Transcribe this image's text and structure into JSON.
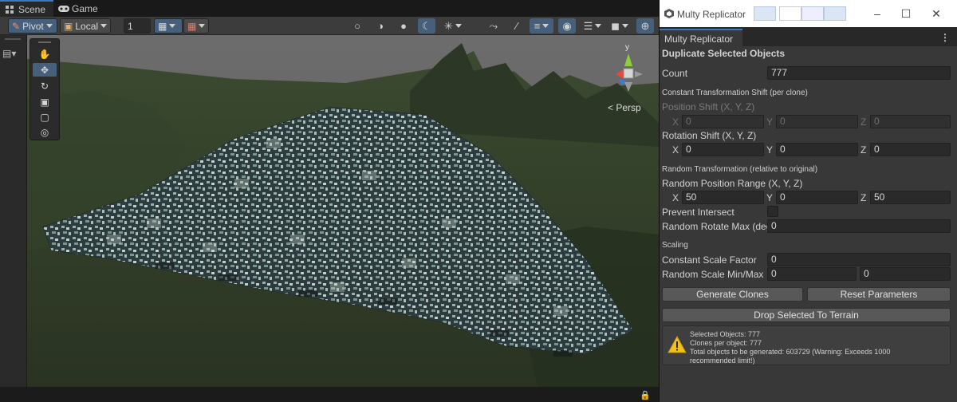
{
  "scene_tabs": [
    {
      "label": "Scene",
      "icon": "grid-icon"
    },
    {
      "label": "Game",
      "icon": "gamepad-icon"
    }
  ],
  "scene_toolbar": {
    "pivot_label": "Pivot",
    "local_label": "Local",
    "grid_snap_value": "1"
  },
  "scene_view": {
    "projection_label": "< Persp",
    "gizmo_axis_y": "y"
  },
  "window": {
    "title": "Multy Replicator",
    "tab_label": "Multy Replicator"
  },
  "replicator": {
    "header": "Duplicate Selected Objects",
    "count_label": "Count",
    "count_value": "777",
    "const_shift_header": "Constant Transformation Shift (per clone)",
    "position_shift_label": "Position Shift (X, Y, Z)",
    "position_shift": {
      "x": "0",
      "y": "0",
      "z": "0"
    },
    "rotation_shift_label": "Rotation Shift (X, Y, Z)",
    "rotation_shift": {
      "x": "0",
      "y": "0",
      "z": "0"
    },
    "random_header": "Random Transformation (relative to original)",
    "random_position_label": "Random Position Range (X, Y, Z)",
    "random_position": {
      "x": "50",
      "y": "0",
      "z": "50"
    },
    "prevent_intersect_label": "Prevent Intersect",
    "prevent_intersect_checked": false,
    "random_rotate_label": "Random Rotate Max (degr",
    "random_rotate_value": "0",
    "scaling_header": "Scaling",
    "const_scale_label": "Constant Scale Factor",
    "const_scale_value": "0",
    "random_scale_label": "Random Scale Min/Max",
    "random_scale_min": "0",
    "random_scale_max": "0",
    "generate_button": "Generate Clones",
    "reset_button": "Reset Parameters",
    "drop_button": "Drop Selected To Terrain",
    "axis_labels": {
      "x": "X",
      "y": "Y",
      "z": "Z"
    }
  },
  "help": {
    "line1": "Selected Objects: 777",
    "line2": "Clones per object: 777",
    "line3": "Total objects to be generated: 603729 (Warning: Exceeds 1000",
    "line4": "recommended limit!)"
  },
  "colors": {
    "accent": "#3a79bb",
    "terrain": "#2f3a26",
    "warning": "#f2c21b"
  }
}
